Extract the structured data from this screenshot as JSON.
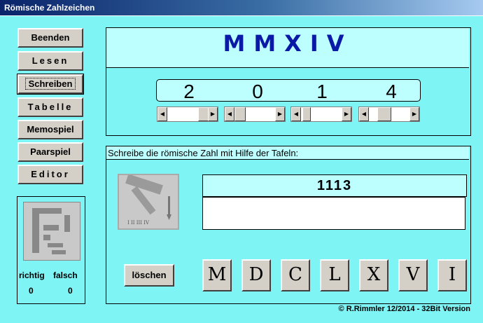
{
  "window": {
    "title": "Römische Zahlzeichen"
  },
  "nav": [
    {
      "label": "Beenden"
    },
    {
      "label": "Lesen"
    },
    {
      "label": "Schreiben",
      "selected": true
    },
    {
      "label": "Tabelle"
    },
    {
      "label": "Memospiel"
    },
    {
      "label": "Paarspiel"
    },
    {
      "label": "Editor"
    }
  ],
  "score": {
    "richtig_label": "richtig",
    "falsch_label": "falsch",
    "richtig": "0",
    "falsch": "0"
  },
  "display": {
    "roman": "MMXIV",
    "digits": [
      "2",
      "0",
      "1",
      "4"
    ]
  },
  "task": {
    "instruction": "Schreibe die römische Zahl mit Hilfe der Tafeln:",
    "number": "1113",
    "answer": ""
  },
  "tools_icon_label": "I II III IV",
  "clear_button": "löschen",
  "letters": [
    "M",
    "D",
    "C",
    "L",
    "X",
    "V",
    "I"
  ],
  "footer": "© R.Rimmler 12/2014 - 32Bit Version",
  "colors": {
    "background": "#7ef4f4",
    "light_panel": "#bdffff",
    "roman_text": "#0b1aa6"
  }
}
